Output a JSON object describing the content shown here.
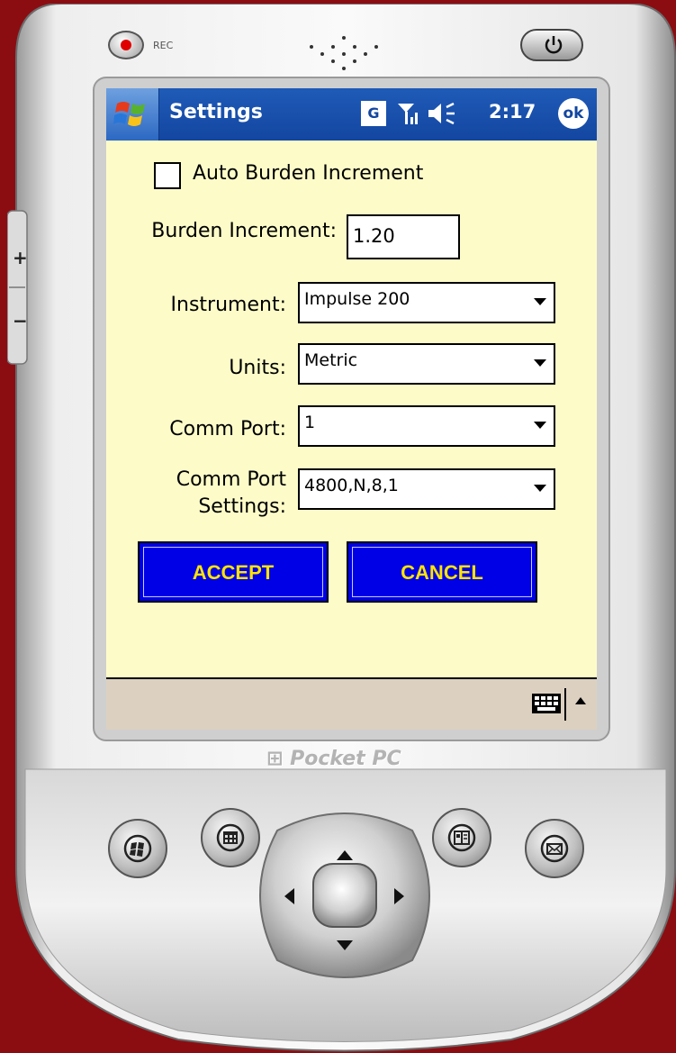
{
  "device": {
    "rec_label": "REC",
    "brand_label": "Pocket PC",
    "volume_up": "+",
    "volume_down": "−"
  },
  "titlebar": {
    "title": "Settings",
    "g_label": "G",
    "time": "2:17",
    "ok_label": "ok"
  },
  "form": {
    "auto_burden_label": "Auto Burden Increment",
    "auto_burden_checked": false,
    "burden_increment_label": "Burden Increment:",
    "burden_increment_value": "1.20",
    "instrument_label": "Instrument:",
    "instrument_value": "Impulse 200",
    "units_label": "Units:",
    "units_value": "Metric",
    "comm_port_label": "Comm Port:",
    "comm_port_value": "1",
    "comm_port_settings_label_line1": "Comm Port",
    "comm_port_settings_label_line2": "Settings:",
    "comm_port_settings_value": "4800,N,8,1",
    "accept_label": "ACCEPT",
    "cancel_label": "CANCEL"
  },
  "colors": {
    "screen_bg": "#fdfcc9",
    "titlebar": "#1346a0",
    "button_bg": "#0000e6",
    "button_text": "#ffe400",
    "frame_bg": "#8b0d12"
  },
  "icons": [
    "record-icon",
    "speaker-grille-icon",
    "power-icon",
    "start-windows-icon",
    "signal-icon",
    "volume-icon",
    "keyboard-icon",
    "windows-flag-icon",
    "calendar-icon",
    "contacts-icon",
    "mail-icon",
    "dpad-up-icon",
    "dpad-down-icon",
    "dpad-left-icon",
    "dpad-right-icon"
  ]
}
